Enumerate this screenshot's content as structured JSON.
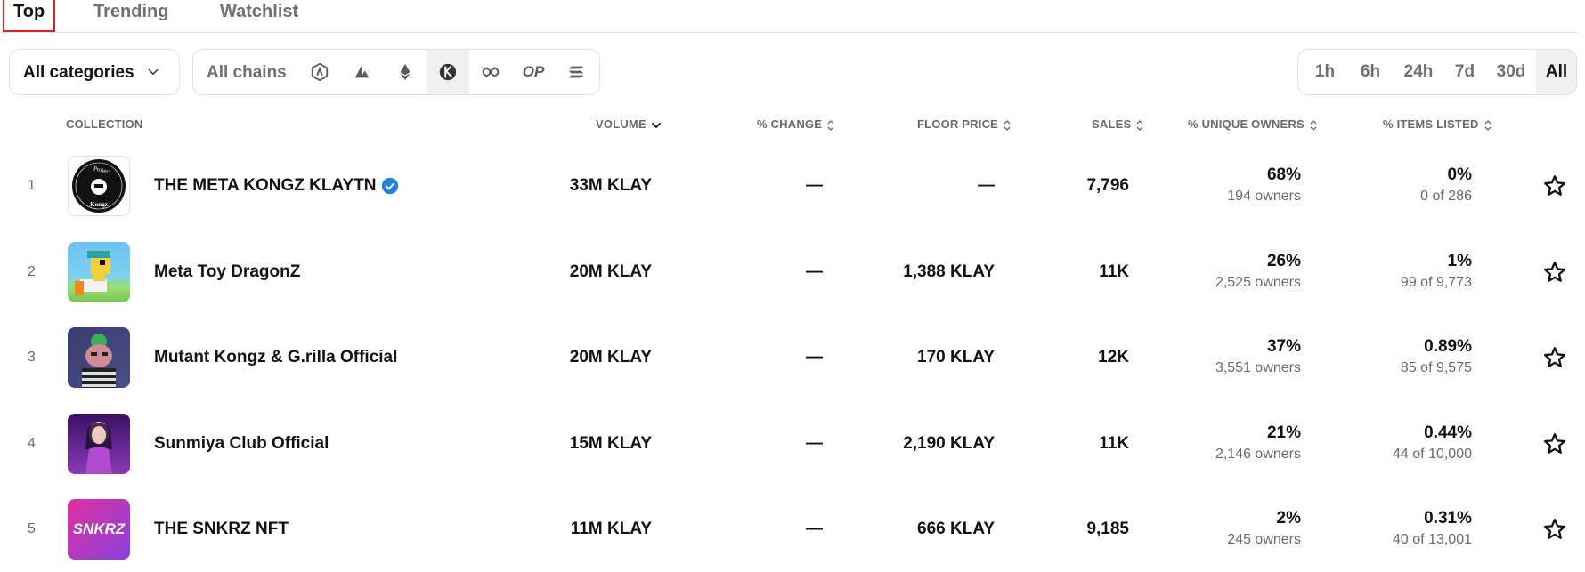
{
  "tabs": {
    "top": "Top",
    "trending": "Trending",
    "watchlist": "Watchlist"
  },
  "filters": {
    "category": "All categories",
    "chains_label": "All chains",
    "chains": [
      "arbitrum-icon",
      "avalanche-icon",
      "ethereum-icon",
      "klaytn-icon",
      "polygon-icon",
      "OP",
      "solana-icon"
    ],
    "selected_chain": "klaytn-icon",
    "time_options": [
      "1h",
      "6h",
      "24h",
      "7d",
      "30d",
      "All"
    ],
    "selected_time": "All"
  },
  "columns": {
    "collection": "COLLECTION",
    "volume": "VOLUME",
    "change": "% CHANGE",
    "floor": "FLOOR PRICE",
    "sales": "SALES",
    "owners": "% UNIQUE OWNERS",
    "listed": "% ITEMS LISTED"
  },
  "rows": [
    {
      "rank": "1",
      "name": "THE META KONGZ KLAYTN",
      "verified": true,
      "volume": "33M KLAY",
      "change": "—",
      "floor": "—",
      "sales": "7,796",
      "owners_pct": "68%",
      "owners": "194 owners",
      "listed_pct": "0%",
      "listed": "0 of 286"
    },
    {
      "rank": "2",
      "name": "Meta Toy DragonZ",
      "verified": false,
      "volume": "20M KLAY",
      "change": "—",
      "floor": "1,388 KLAY",
      "sales": "11K",
      "owners_pct": "26%",
      "owners": "2,525 owners",
      "listed_pct": "1%",
      "listed": "99 of 9,773"
    },
    {
      "rank": "3",
      "name": "Mutant Kongz & G.rilla Official",
      "verified": false,
      "volume": "20M KLAY",
      "change": "—",
      "floor": "170 KLAY",
      "sales": "12K",
      "owners_pct": "37%",
      "owners": "3,551 owners",
      "listed_pct": "0.89%",
      "listed": "85 of 9,575"
    },
    {
      "rank": "4",
      "name": "Sunmiya Club Official",
      "verified": false,
      "volume": "15M KLAY",
      "change": "—",
      "floor": "2,190 KLAY",
      "sales": "11K",
      "owners_pct": "21%",
      "owners": "2,146 owners",
      "listed_pct": "0.44%",
      "listed": "44 of 10,000"
    },
    {
      "rank": "5",
      "name": "THE SNKRZ NFT",
      "verified": false,
      "volume": "11M KLAY",
      "change": "—",
      "floor": "666 KLAY",
      "sales": "9,185",
      "owners_pct": "2%",
      "owners": "245 owners",
      "listed_pct": "0.31%",
      "listed": "40 of 13,001"
    }
  ],
  "thumb_logos": {
    "kongz_top": "Project",
    "kongz_bottom": "Kongz",
    "snkrz": "SNKRZ"
  },
  "colors": {
    "accent_selected": "#f0f0f0",
    "verified": "#2081e2",
    "tab_outline": "#e02020"
  }
}
